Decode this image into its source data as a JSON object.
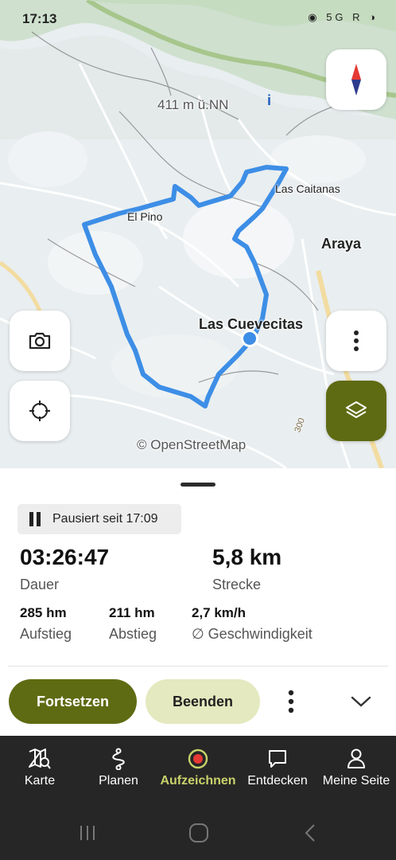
{
  "status_bar": {
    "time": "17:13",
    "icons": "◉ 5G R ◑"
  },
  "map": {
    "labels": {
      "elevation": "411 m ü.NN",
      "el_pino": "El Pino",
      "las_caitanas": "Las Caitanas",
      "araya": "Araya",
      "las_cuevecitas": "Las Cuevecitas",
      "attribution": "© OpenStreetMap",
      "contour": "300"
    },
    "route_color": "#3d8ee6",
    "accent": "#5f6b12"
  },
  "recording": {
    "paused_label": "Pausiert seit 17:09",
    "duration_value": "03:26:47",
    "duration_label": "Dauer",
    "distance_value": "5,8 km",
    "distance_label": "Strecke",
    "ascent_value": "285 hm",
    "ascent_label": "Aufstieg",
    "descent_value": "211 hm",
    "descent_label": "Abstieg",
    "speed_value": "2,7 km/h",
    "speed_label": "∅ Geschwindigkeit",
    "resume_button": "Fortsetzen",
    "finish_button": "Beenden"
  },
  "bottom_nav": {
    "items": [
      {
        "label": "Karte",
        "icon": "map-search-icon"
      },
      {
        "label": "Planen",
        "icon": "route-plan-icon"
      },
      {
        "label": "Aufzeichnen",
        "icon": "record-icon",
        "active": true
      },
      {
        "label": "Entdecken",
        "icon": "speech-bubble-icon"
      },
      {
        "label": "Meine Seite",
        "icon": "person-icon"
      }
    ]
  }
}
